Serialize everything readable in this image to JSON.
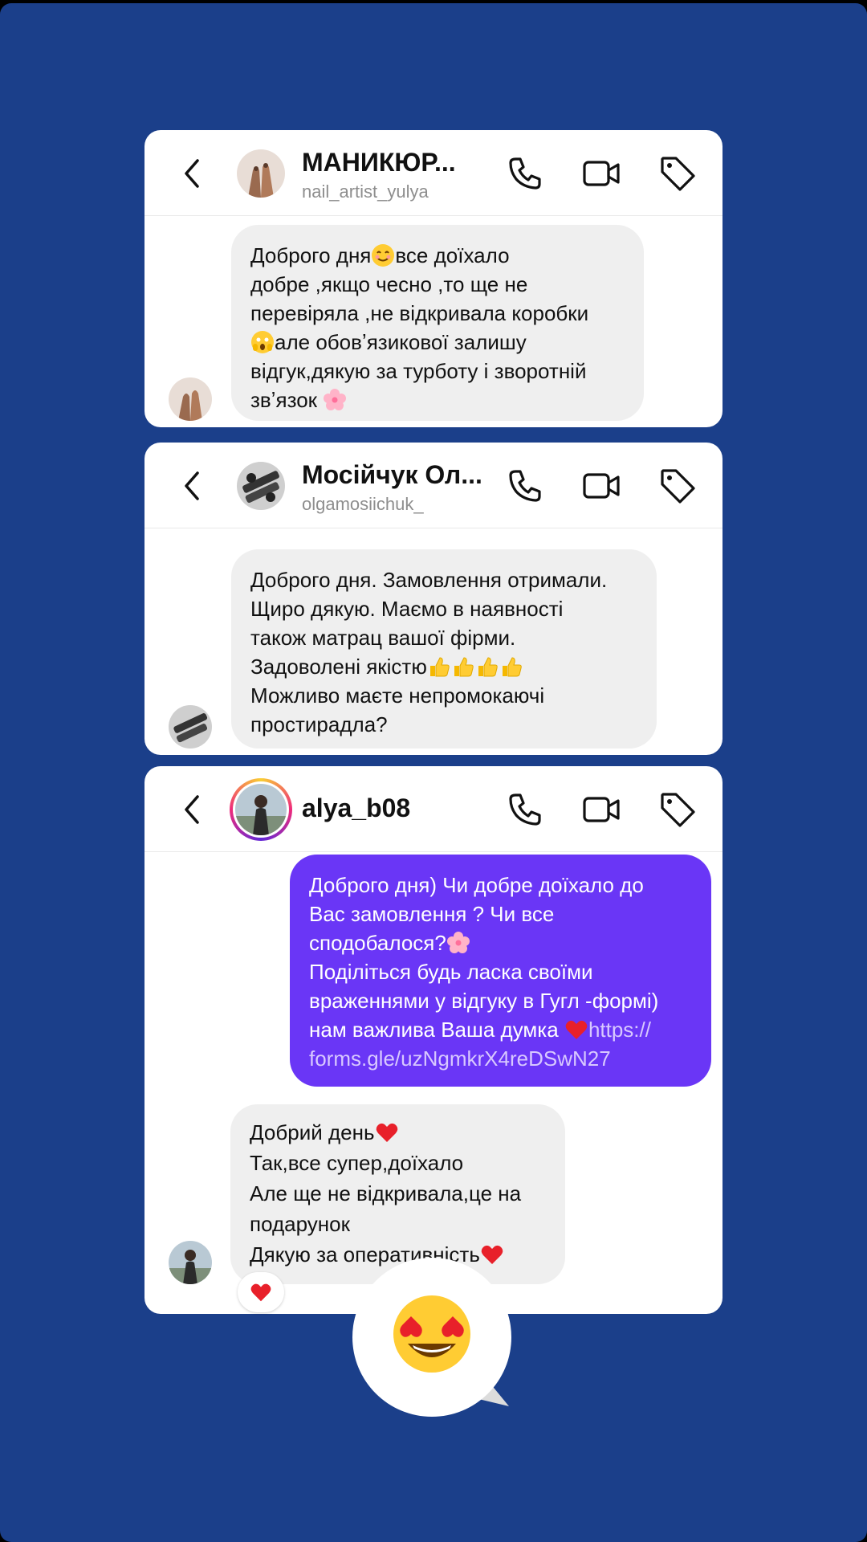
{
  "chats": [
    {
      "name": "МАНИКЮР...",
      "username": "nail_artist_yulya",
      "message_lines": [
        "Доброго дня",
        "все доїхало",
        "добре ,якщо чесно ,то ще не",
        "перевіряла ,не відкривала коробки",
        "але обовʼязикової залишу",
        "відгук,дякую за турботу і зворотній",
        "звʼязок"
      ]
    },
    {
      "name": "Мосійчук Ол...",
      "username": "olgamosiichuk_",
      "message_lines": [
        "Доброго дня. Замовлення отримали.",
        "Щиро дякую. Маємо в наявності",
        "також матрац вашої фірми.",
        "Задоволені якістю",
        "Можливо маєте непромокаючі",
        "простирадла?"
      ]
    },
    {
      "name": "alya_b08",
      "outgoing_lines": [
        "Доброго дня) Чи добре доїхало до",
        "Вас замовлення ? Чи все",
        "сподобалося?",
        "Поділіться будь ласка своїми",
        "враженнями у відгуку в Гугл -формі)",
        "нам важлива Ваша думка",
        "https://",
        "forms.gle/uzNgmkrX4reDSwN27"
      ],
      "incoming_lines": [
        "Добрий день",
        "Так,все супер,доїхало",
        "Але ще не відкривала,це на",
        "подарунок",
        "Дякую за оперативність"
      ]
    }
  ],
  "colors": {
    "background": "#1b3f8a",
    "outgoing_bubble": "#6a36f6",
    "incoming_bubble": "#efefef"
  },
  "icons": [
    "back-icon",
    "phone-icon",
    "video-icon",
    "tag-icon"
  ]
}
